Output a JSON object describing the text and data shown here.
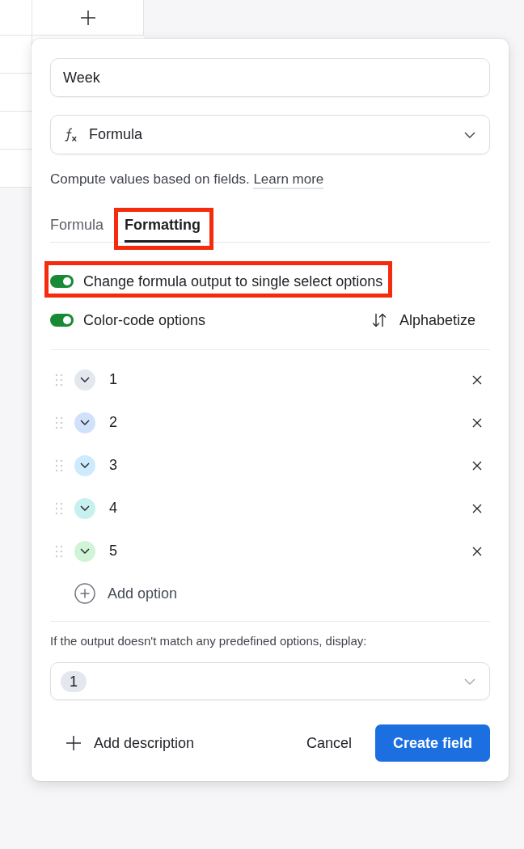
{
  "field_dialog": {
    "name_input": {
      "value": "Week"
    },
    "type_select": {
      "value": "Formula"
    },
    "description": {
      "text": "Compute values based on fields.",
      "link": "Learn more"
    },
    "tabs": [
      {
        "label": "Formula",
        "selected": false,
        "highlighted": false
      },
      {
        "label": "Formatting",
        "selected": true,
        "highlighted": true
      }
    ],
    "toggles": [
      {
        "label": "Change formula output to single select options",
        "on": true,
        "highlighted": true
      },
      {
        "label": "Color-code options",
        "on": true,
        "highlighted": false
      }
    ],
    "sort_button": {
      "label": "Alphabetize"
    },
    "options": [
      {
        "label": "1",
        "color": "#e4e7ee"
      },
      {
        "label": "2",
        "color": "#d2e1fb"
      },
      {
        "label": "3",
        "color": "#cdebfc"
      },
      {
        "label": "4",
        "color": "#c7f1ee"
      },
      {
        "label": "5",
        "color": "#d0f4d6"
      }
    ],
    "add_option": {
      "label": "Add option"
    },
    "fallback": {
      "label": "If the output doesn't match any predefined options, display:",
      "value": "1"
    },
    "footer": {
      "add_description": "Add description",
      "cancel": "Cancel",
      "create": "Create field"
    }
  }
}
